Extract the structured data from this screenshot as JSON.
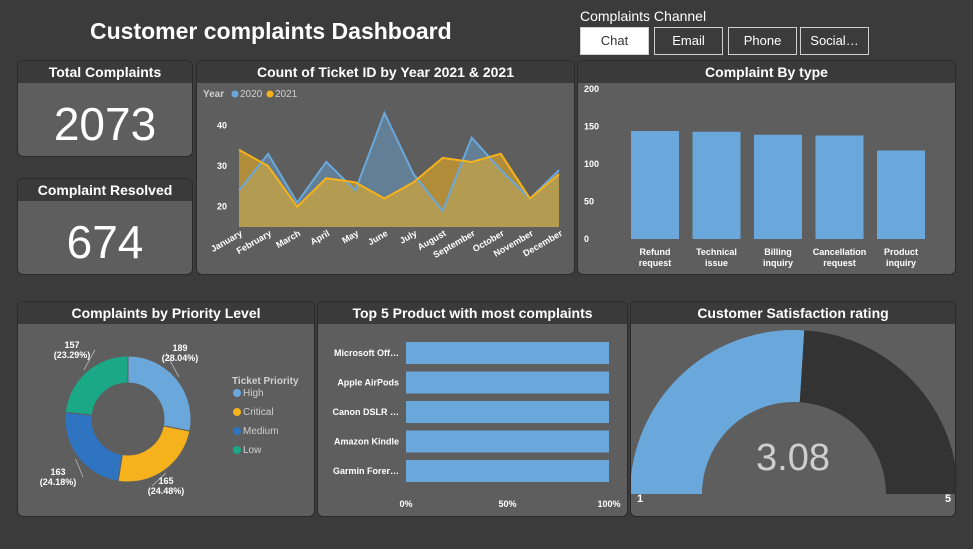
{
  "header": {
    "title": "Customer complaints Dashboard"
  },
  "slicer": {
    "title": "Complaints Channel",
    "options": [
      "Chat",
      "Email",
      "Phone",
      "Social…"
    ],
    "selected": "Chat"
  },
  "kpis": {
    "total": {
      "label": "Total Complaints",
      "value": "2073"
    },
    "resolved": {
      "label": "Complaint Resolved",
      "value": "674"
    }
  },
  "colors": {
    "c2020": "#6aa8dc",
    "c2021": "#f5b21c",
    "high": "#6aa8dc",
    "critical": "#f5b21c",
    "medium": "#2f74c0",
    "low": "#1aa886",
    "bar": "#6aa8dc",
    "gauge_fill": "#6aa8dc",
    "gauge_bg": "#333333"
  },
  "chart_data": [
    {
      "type": "area",
      "title": "Count of Ticket ID by Year 2021 & 2021",
      "legend_title": "Year",
      "categories": [
        "January",
        "February",
        "March",
        "April",
        "May",
        "June",
        "July",
        "August",
        "September",
        "October",
        "November",
        "December"
      ],
      "series": [
        {
          "name": "2020",
          "values": [
            24,
            33,
            21,
            31,
            24,
            43,
            28,
            19,
            37,
            29,
            22,
            29
          ]
        },
        {
          "name": "2021",
          "values": [
            34,
            30,
            20,
            27,
            26,
            22,
            26,
            32,
            31,
            33,
            22,
            28
          ]
        }
      ],
      "y_ticks": [
        "20",
        "30",
        "40"
      ],
      "ylim": [
        15,
        46
      ]
    },
    {
      "type": "bar",
      "title": "Complaint By type",
      "categories": [
        "Refund request",
        "Technical issue",
        "Billing inquiry",
        "Cancellation request",
        "Product inquiry"
      ],
      "category_lines": [
        [
          "Refund",
          "request"
        ],
        [
          "Technical",
          "issue"
        ],
        [
          "Billing",
          "inquiry"
        ],
        [
          "Cancellation",
          "request"
        ],
        [
          "Product",
          "inquiry"
        ]
      ],
      "values": [
        144,
        143,
        139,
        138,
        118
      ],
      "y_ticks": [
        "0",
        "50",
        "100",
        "150",
        "200"
      ],
      "ylim": [
        0,
        200
      ]
    },
    {
      "type": "pie",
      "title": "Complaints by Priority Level",
      "legend_title": "Ticket Priority",
      "series": [
        {
          "name": "High",
          "value": 189,
          "label": "189",
          "pct": "(28.04%)"
        },
        {
          "name": "Critical",
          "value": 165,
          "label": "165",
          "pct": "(24.48%)"
        },
        {
          "name": "Medium",
          "value": 163,
          "label": "163",
          "pct": "(24.18%)"
        },
        {
          "name": "Low",
          "value": 157,
          "label": "157",
          "pct": "(23.29%)"
        }
      ]
    },
    {
      "type": "bar",
      "orientation": "horizontal",
      "title": "Top 5 Product with most complaints",
      "categories": [
        "Microsoft Off…",
        "Apple AirPods",
        "Canon DSLR …",
        "Amazon Kindle",
        "Garmin Forer…"
      ],
      "values": [
        100,
        100,
        100,
        100,
        100
      ],
      "x_ticks": [
        "0%",
        "50%",
        "100%"
      ],
      "xlim": [
        0,
        100
      ]
    },
    {
      "type": "gauge",
      "title": "Customer Satisfaction rating",
      "value": 3.08,
      "value_label": "3.08",
      "min": 1,
      "max": 5,
      "min_label": "1",
      "max_label": "5"
    }
  ]
}
